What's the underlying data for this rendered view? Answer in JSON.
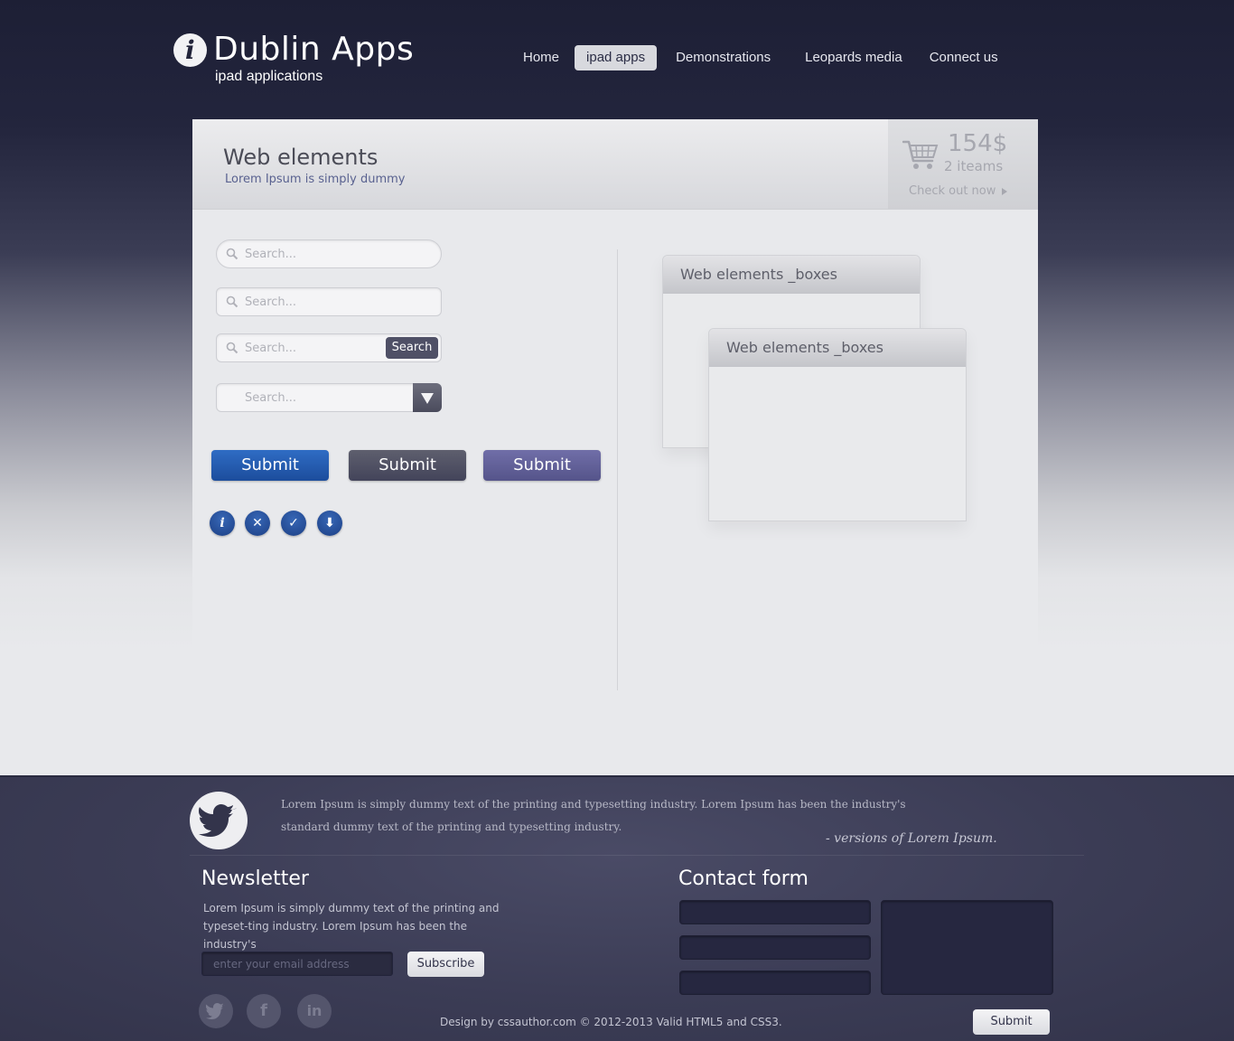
{
  "header": {
    "brand_icon": "info-i-icon",
    "title": "Dublin Apps",
    "subtitle": "ipad applications",
    "nav": [
      {
        "label": "Home",
        "active": false
      },
      {
        "label": "ipad apps",
        "active": true
      },
      {
        "label": "Demonstrations",
        "active": false
      },
      {
        "label": "Leopards media",
        "active": false
      },
      {
        "label": "Connect us",
        "active": false
      }
    ]
  },
  "panel": {
    "title": "Web elements",
    "subtitle": "Lorem Ipsum is simply dummy",
    "cart": {
      "icon": "shopping-cart-icon",
      "price": "154$",
      "items": "2 iteams",
      "checkout": "Check out now"
    }
  },
  "forms": {
    "search_placeholder": "Search...",
    "search_button": "Search",
    "submit_label": "Submit",
    "submit_colors": [
      "#1f55a6",
      "#4a4b5e",
      "#5e5c98"
    ],
    "icons": [
      "info-icon",
      "close-icon",
      "check-icon",
      "download-arrow-icon"
    ],
    "icon_glyphs": [
      "i",
      "✕",
      "✓",
      "⬇"
    ]
  },
  "boxes": [
    {
      "title": "Web elements _boxes"
    },
    {
      "title": "Web elements _boxes"
    }
  ],
  "footer": {
    "tweet_icon": "twitter-bird-icon",
    "tweet_text": "Lorem Ipsum is simply dummy text of the printing and typesetting industry. Lorem Ipsum has been the industry's standard dummy text  of the printing and typesetting industry.",
    "tweet_quote": "- versions of Lorem Ipsum.",
    "newsletter": {
      "title": "Newsletter",
      "text": "Lorem Ipsum is simply dummy text of the printing and typeset-ting industry. Lorem Ipsum has been the industry's",
      "placeholder": "enter your email address",
      "button": "Subscribe"
    },
    "social": [
      "t",
      "f",
      "in"
    ],
    "social_icons": [
      "twitter-icon",
      "facebook-icon",
      "linkedin-icon"
    ],
    "copyright": "Design by cssauthor.com © 2012-2013  Valid HTML5 and CSS3.",
    "contact": {
      "title": "Contact form",
      "submit": "Submit"
    }
  }
}
